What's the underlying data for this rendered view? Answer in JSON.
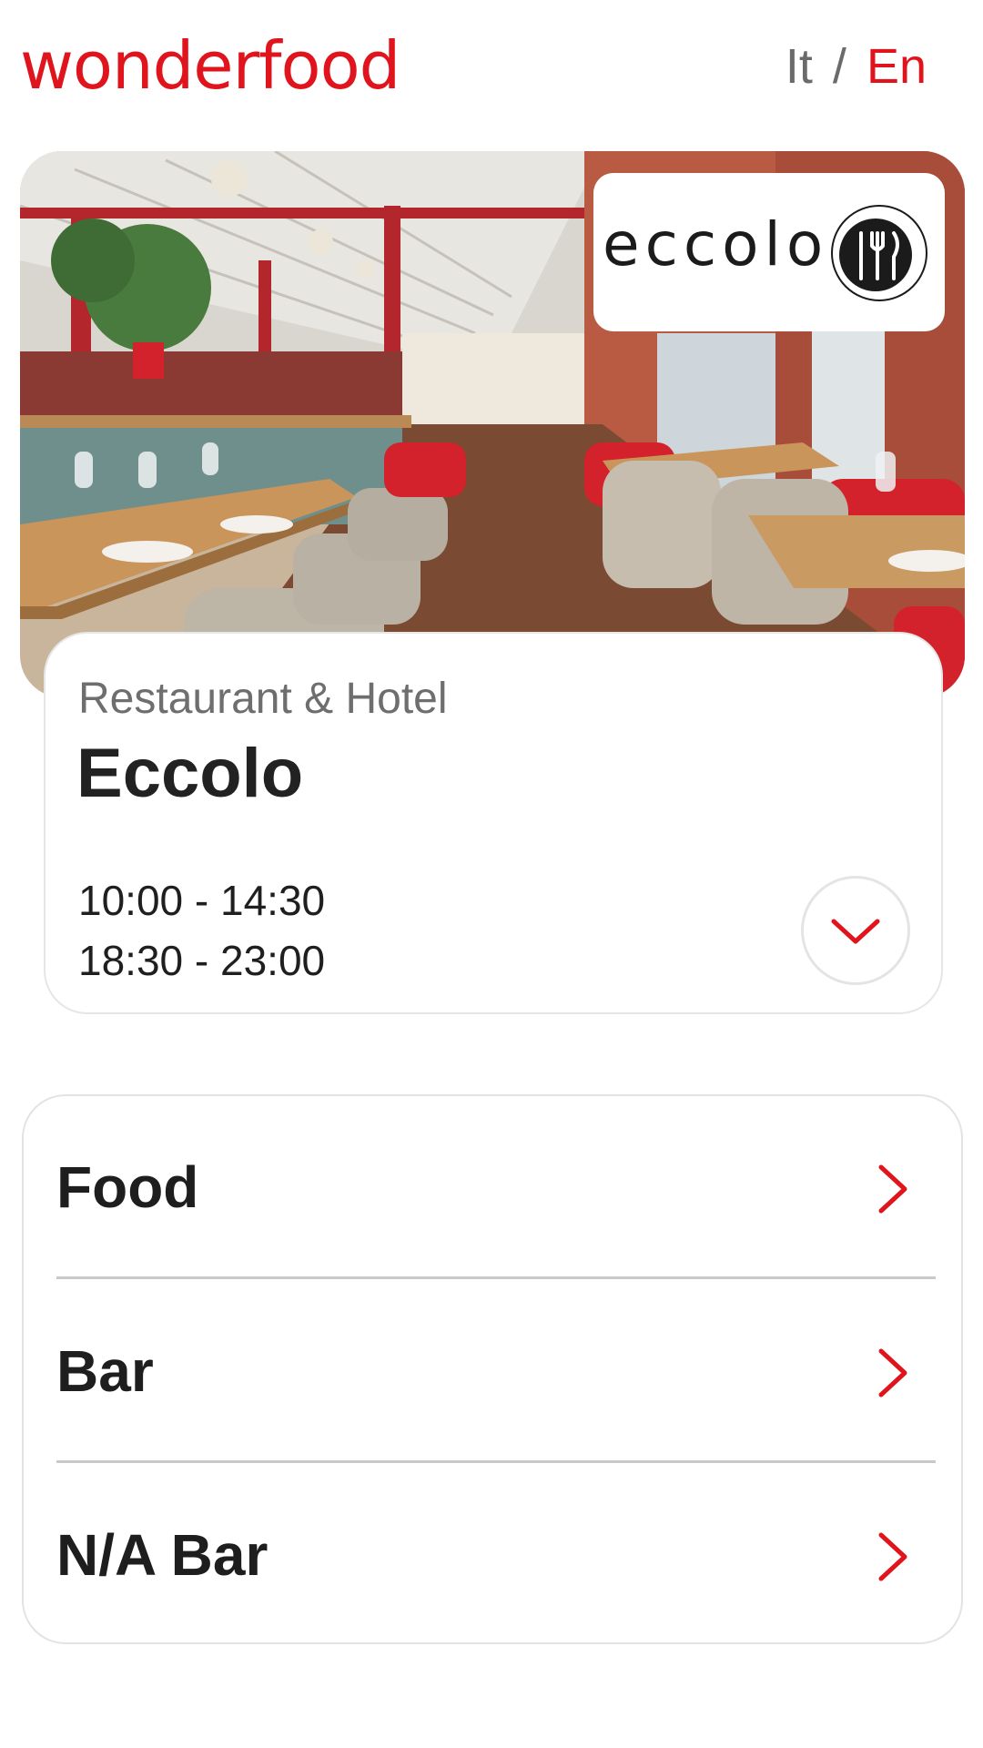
{
  "header": {
    "logo_text": "wonderfood",
    "lang": {
      "it": "It",
      "separator": "/",
      "en": "En"
    }
  },
  "colors": {
    "accent": "#e0141c",
    "muted_text": "#6e6e6e"
  },
  "hero": {
    "brand_name": "eccolo",
    "brand_icon": "fork-and-knife-icon"
  },
  "venue": {
    "category": "Restaurant & Hotel",
    "name": "Eccolo",
    "hours": [
      "10:00 - 14:30",
      "18:30 - 23:00"
    ],
    "expand_icon": "chevron-down-icon"
  },
  "menu": {
    "items": [
      {
        "label": "Food",
        "icon": "chevron-right-icon"
      },
      {
        "label": "Bar",
        "icon": "chevron-right-icon"
      },
      {
        "label": "N/A Bar",
        "icon": "chevron-right-icon"
      }
    ]
  }
}
